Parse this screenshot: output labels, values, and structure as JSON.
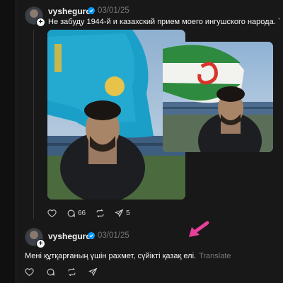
{
  "post1": {
    "username": "vyshegurof",
    "date": "03/01/25",
    "text": "Не забуду 1944-й и казахский прием моего ингушского народа. `",
    "actions": {
      "replies": "66",
      "shares": "5"
    }
  },
  "post2": {
    "username": "vyshegurof",
    "date": "03/01/25",
    "text": "Мені құтқарғаның үшін рахмет, сүйікті қазақ елі.",
    "translate": "Translate"
  },
  "colors": {
    "background": "#101010",
    "panel": "#181818",
    "verified": "#0095f6",
    "muted": "#777777",
    "arrow": "#e8409a"
  },
  "icons": [
    "heart-icon",
    "comment-icon",
    "repost-icon",
    "share-icon",
    "verified-badge-icon",
    "follow-plus-icon"
  ]
}
